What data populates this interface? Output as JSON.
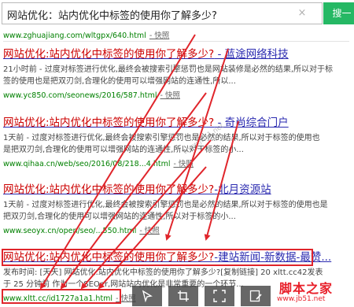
{
  "search": {
    "query": "网站优化：站内优化中标签的使用你了解多少?",
    "clear_icon": "×",
    "button_label": "搜一"
  },
  "top_result": {
    "url": "www.zghuajiang.com/wltgpx/640.html",
    "snapshot": "- 快照"
  },
  "results": [
    {
      "title_hl": "网站优化:站内优化中标签的使用你了解多少?",
      "title_rest": " - 蓝途网络科技",
      "snippet_l1": "21小时前 - 过度对标签进行优化,最终会被搜索引擎惩罚也是网站装修是必然的结果,所以对于标",
      "snippet_l2": "签的使用也是把双刃剑,合理化的使用可以增强网站的连通性,所以...",
      "url": "www.yc850.com/seonews/2016/587.html",
      "snapshot": "- 快照"
    },
    {
      "title_hl": "网站优化:站内优化中标签的使用你了解多少?",
      "title_rest": " - 奇尚综合门户",
      "snippet_l1": "1天前 - 过度对标签进行优化,最终会被搜索引擎惩罚也是必然的结果,所以对于标签的使用也",
      "snippet_l2": "是把双刃剑,合理化的使用可以增强网站的连通性,所以对于标签的小...",
      "url": "www.qihaa.cn/web/seo/2016/08/218...4.html",
      "snapshot": "- 快照"
    },
    {
      "title_hl": "网站优化:站内优化中标签的使用你了解多少?",
      "title_rest": "-北月资源站",
      "snippet_l1": "1天前 - 过度对标签进行优化,最终会被搜索引擎惩罚也是必然的结果,所以对于标签的使用也是",
      "snippet_l2": "把双刃剑,合理化的使用可以增强网站的连通性,所以对于标签的小...",
      "url": "www.seoyx.cn/open/seo/...550.html",
      "snapshot": "- 快照"
    },
    {
      "title_hl": "网站优化:站内优化中标签的使用你了解多少?",
      "title_rest": "-建站新闻-新数据-最赞...",
      "snippet_l1": "发布时间: [天天] 网站优化:站内优化中标签的使用你了解多少?[复制链接] 20 xltt.cc42发表",
      "snippet_l2": "于 25 分钟前 作为一个SEOer,网站站内优化是非常重要的一个环节...",
      "url": "www.xltt.cc/id1727a1a1.html",
      "snapshot": "- 快照"
    }
  ],
  "watermark_text": "www.jb51.net",
  "toolbar_icons": [
    "pointer-icon",
    "crop-icon",
    "fullscreen-icon",
    "edit-icon"
  ],
  "logo": {
    "main": "脚本之家",
    "sub": "www.jb51.net"
  },
  "colors": {
    "title_link": "#2a2ab0",
    "highlight": "#cc0000",
    "url_green": "#008000",
    "annotation_red": "#e0252b",
    "search_button": "#25b864"
  }
}
